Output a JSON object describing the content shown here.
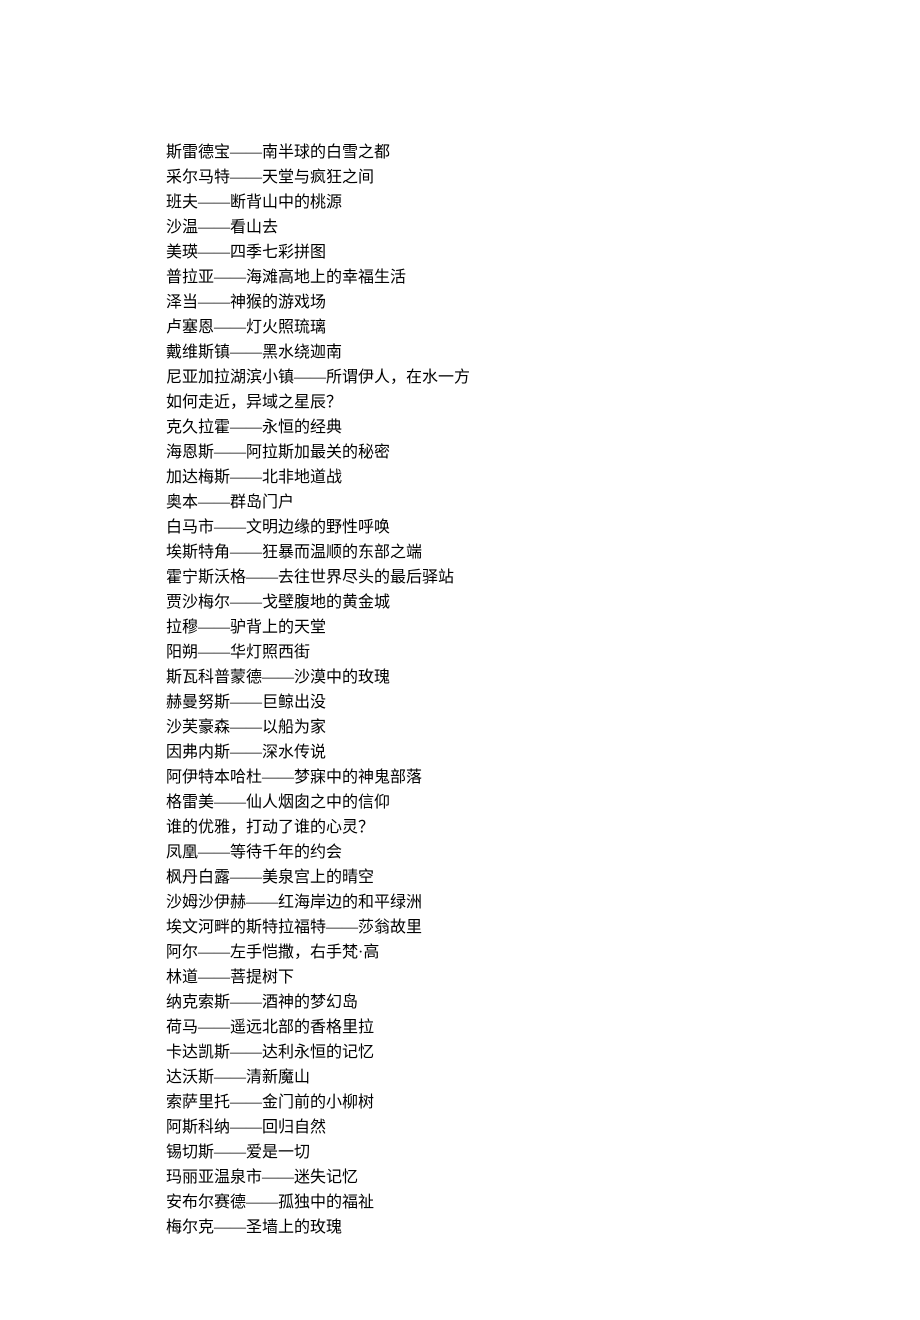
{
  "lines": [
    "斯雷德宝——南半球的白雪之都",
    "采尔马特——天堂与疯狂之间",
    "班夫——断背山中的桃源",
    "沙温——看山去",
    "美瑛——四季七彩拼图",
    "普拉亚——海滩高地上的幸福生活",
    "泽当——神猴的游戏场",
    "卢塞恩——灯火照琉璃",
    "戴维斯镇——黑水绕迦南",
    "尼亚加拉湖滨小镇——所谓伊人，在水一方",
    "如何走近，异域之星辰？",
    "克久拉霍——永恒的经典",
    "海恩斯——阿拉斯加最关的秘密",
    "加达梅斯——北非地道战",
    "奥本——群岛门户",
    "白马市——文明边缘的野性呼唤",
    "埃斯特角——狂暴而温顺的东部之端",
    "霍宁斯沃格——去往世界尽头的最后驿站",
    "贾沙梅尔——戈壁腹地的黄金城",
    "拉穆——驴背上的天堂",
    "阳朔——华灯照西街",
    "斯瓦科普蒙德——沙漠中的玫瑰",
    "赫曼努斯——巨鲸出没",
    "沙芙豪森——以船为家",
    "因弗内斯——深水传说",
    "阿伊特本哈杜——梦寐中的神鬼部落",
    "格雷美——仙人烟囱之中的信仰",
    "谁的优雅，打动了谁的心灵？",
    "凤凰——等待千年的约会",
    "枫丹白露——美泉宫上的晴空",
    "沙姆沙伊赫——红海岸边的和平绿洲",
    "埃文河畔的斯特拉福特——莎翁故里",
    "阿尔——左手恺撒，右手梵·高",
    "林道——菩提树下",
    "纳克索斯——酒神的梦幻岛",
    "荷马——遥远北部的香格里拉",
    "卡达凯斯——达利永恒的记忆",
    "达沃斯——清新魔山",
    "索萨里托——金门前的小柳树",
    "阿斯科纳——回归自然",
    "锡切斯——爱是一切",
    "玛丽亚温泉市——迷失记忆",
    "安布尔赛德——孤独中的福祉",
    "梅尔克——圣墙上的玫瑰"
  ]
}
